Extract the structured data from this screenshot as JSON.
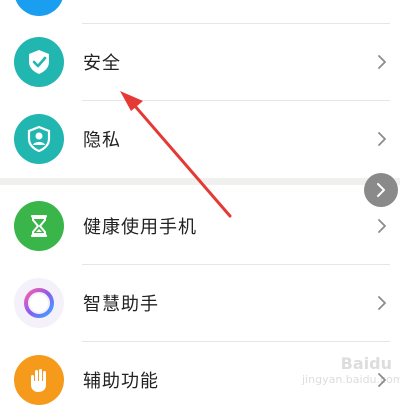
{
  "settings_list": {
    "items": [
      {
        "label": "安全",
        "icon": "shield-check-icon",
        "color": "#21b6b0"
      },
      {
        "label": "隐私",
        "icon": "privacy-person-icon",
        "color": "#21b6b0"
      },
      {
        "label": "健康使用手机",
        "icon": "hourglass-icon",
        "color": "#3ab54a"
      },
      {
        "label": "智慧助手",
        "icon": "assistant-ring-icon",
        "color": "#8a5cf0"
      },
      {
        "label": "辅助功能",
        "icon": "hand-icon",
        "color": "#f59a1b"
      }
    ]
  },
  "annotation": {
    "arrow_color": "#e53935"
  },
  "floating_button": {
    "icon": "chevron-right-icon",
    "color": "#8a8a8a"
  },
  "watermark": {
    "brand": "Baidu",
    "site": "jingyan.baidu.com"
  }
}
